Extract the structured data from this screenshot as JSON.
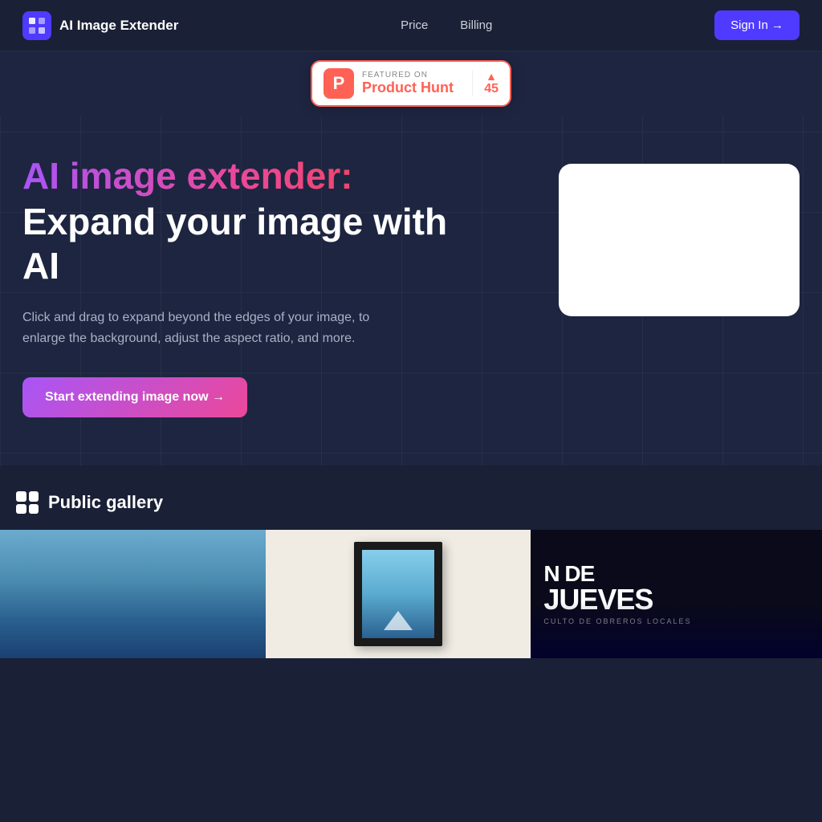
{
  "nav": {
    "logo_text": "AI Image Extender",
    "links": [
      {
        "label": "Price",
        "id": "price"
      },
      {
        "label": "Billing",
        "id": "billing"
      }
    ],
    "sign_in_label": "Sign In →"
  },
  "product_hunt": {
    "featured_on": "FEATURED ON",
    "name": "Product Hunt",
    "votes": "45"
  },
  "hero": {
    "title_gradient": "AI image extender:",
    "title_main": "Expand your image with AI",
    "description": "Click and drag to expand beyond the edges of your image, to enlarge the background, adjust the aspect ratio, and more.",
    "cta_label": "Start extending image now →"
  },
  "gallery": {
    "title": "Public gallery",
    "icon_label": "gallery-icon"
  },
  "thumbs": [
    {
      "id": "thumb-blue-sky",
      "alt": "Blue sky landscape"
    },
    {
      "id": "thumb-framed-art",
      "alt": "Framed mountain artwork"
    },
    {
      "id": "thumb-jueves",
      "title_n": "N DE",
      "title_jueves": "JUEVES",
      "subtitle": "CULTO DE OBREROS LOCALES"
    }
  ]
}
